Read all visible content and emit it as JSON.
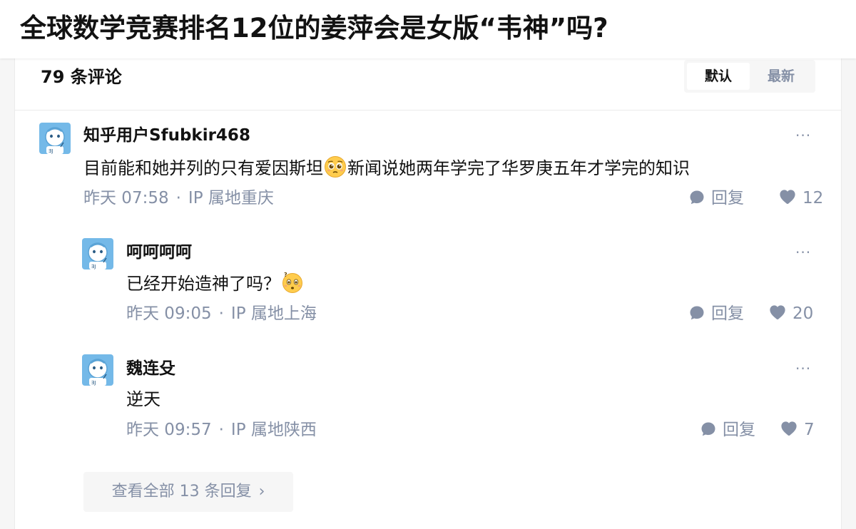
{
  "question": {
    "title": "全球数学竞赛排名12位的姜萍会是女版“韦神”吗?"
  },
  "comments_header": {
    "count_label": "79 条评论",
    "sort_default": "默认",
    "sort_latest": "最新"
  },
  "comments": [
    {
      "author": "知乎用户Sfubkir468",
      "content_before_emoji": "目前能和她并列的只有爱因斯坦",
      "content_after_emoji": "新闻说她两年学完了华罗庚五年才学完的知识",
      "emoji": "pleading-face-emoji",
      "time": "昨天 07:58",
      "sep": "·",
      "location": "IP 属地重庆",
      "reply_label": "回复",
      "likes": "12",
      "more_label": "···"
    },
    {
      "author": "呵呵呵呵",
      "content_before_emoji": "已经开始造神了吗？",
      "content_after_emoji": "",
      "emoji": "confused-face-emoji",
      "time": "昨天 09:05",
      "sep": "·",
      "location": "IP 属地上海",
      "reply_label": "回复",
      "likes": "20",
      "more_label": "···"
    },
    {
      "author": "魏连殳",
      "content_before_emoji": "逆天",
      "content_after_emoji": "",
      "emoji": "",
      "time": "昨天 09:57",
      "sep": "·",
      "location": "IP 属地陕西",
      "reply_label": "回复",
      "likes": "7",
      "more_label": "···"
    }
  ],
  "view_all": {
    "label": "查看全部 13 条回复",
    "chevron": "›"
  },
  "icons": {
    "avatar": "default-avatar-icon",
    "reply": "comment-bubble-icon",
    "like": "heart-icon",
    "more": "more-icon"
  },
  "colors": {
    "meta_gray": "#8590a6",
    "text": "#121212",
    "avatar_blue": "#6fb6e6"
  }
}
